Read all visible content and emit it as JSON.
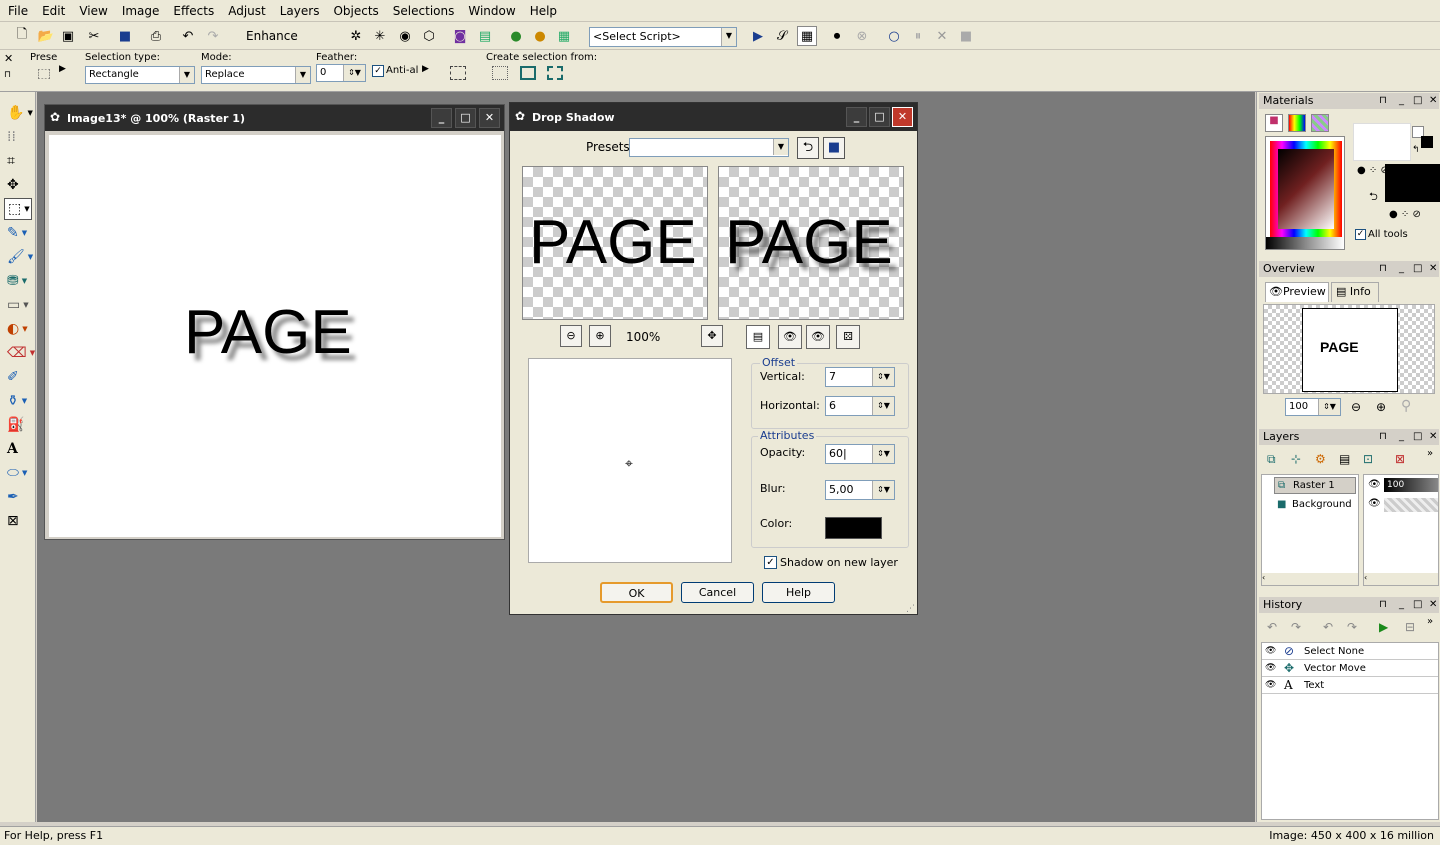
{
  "menu": [
    "File",
    "Edit",
    "View",
    "Image",
    "Effects",
    "Adjust",
    "Layers",
    "Objects",
    "Selections",
    "Window",
    "Help"
  ],
  "toolbar": {
    "enhance_label": "Enhance Photo",
    "script_select": "<Select Script>"
  },
  "tool_options": {
    "presets_label": "Prese",
    "selection_type_label": "Selection type:",
    "selection_type_value": "Rectangle",
    "mode_label": "Mode:",
    "mode_value": "Replace",
    "feather_label": "Feather:",
    "feather_value": "0",
    "antialias_label": "Anti-al",
    "create_selection_label": "Create selection from:"
  },
  "image_window": {
    "title": "Image13* @ 100% (Raster 1)",
    "canvas_text": "PAGE"
  },
  "dialog": {
    "title": "Drop Shadow",
    "presets_label": "Presets:",
    "preview_text": "PAGE",
    "zoom": "100%",
    "offset_label": "Offset",
    "vertical_label": "Vertical:",
    "vertical_value": "7",
    "horizontal_label": "Horizontal:",
    "horizontal_value": "6",
    "attributes_label": "Attributes",
    "opacity_label": "Opacity:",
    "opacity_value": "60",
    "blur_label": "Blur:",
    "blur_value": "5,00",
    "color_label": "Color:",
    "color_value": "#000000",
    "shadow_new_layer_label": "Shadow on new layer",
    "ok": "OK",
    "cancel": "Cancel",
    "help": "Help"
  },
  "materials": {
    "title": "Materials",
    "all_tools_label": "All tools"
  },
  "overview": {
    "title": "Overview",
    "tab_preview": "Preview",
    "tab_info": "Info",
    "thumb_text": "PAGE",
    "zoom_value": "100"
  },
  "layers": {
    "title": "Layers",
    "items": [
      {
        "name": "Raster 1",
        "opacity": "100"
      },
      {
        "name": "Background"
      }
    ]
  },
  "history": {
    "title": "History",
    "items": [
      "Select None",
      "Vector Move",
      "Text"
    ]
  },
  "status": {
    "left": "For Help, press F1",
    "right": "Image:  450 x 400 x 16 million"
  }
}
